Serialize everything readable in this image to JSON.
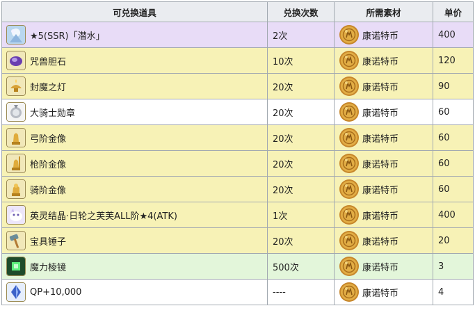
{
  "header": {
    "col_item": "可兑换道具",
    "col_times": "兑换次数",
    "col_material": "所需素材",
    "col_price": "单价"
  },
  "rows": [
    {
      "item": "★5(SSR)「潜水」",
      "times": "2次",
      "material": "康诺特币",
      "price": "400",
      "bg": "purple",
      "icon": "ssr-card-icon"
    },
    {
      "item": "咒兽胆石",
      "times": "10次",
      "material": "康诺特币",
      "price": "120",
      "bg": "yellow",
      "icon": "purple-gem-icon"
    },
    {
      "item": "封魔之灯",
      "times": "20次",
      "material": "康诺特币",
      "price": "90",
      "bg": "yellow",
      "icon": "lamp-icon"
    },
    {
      "item": "大骑士勋章",
      "times": "20次",
      "material": "康诺特币",
      "price": "60",
      "bg": "white",
      "icon": "medal-icon"
    },
    {
      "item": "弓阶金像",
      "times": "20次",
      "material": "康诺特币",
      "price": "60",
      "bg": "yellow",
      "icon": "archer-statue-icon"
    },
    {
      "item": "枪阶金像",
      "times": "20次",
      "material": "康诺特币",
      "price": "60",
      "bg": "yellow",
      "icon": "lancer-statue-icon"
    },
    {
      "item": "骑阶金像",
      "times": "20次",
      "material": "康诺特币",
      "price": "60",
      "bg": "yellow",
      "icon": "rider-statue-icon"
    },
    {
      "item": "英灵结晶·日轮之芙芙ALL阶★4(ATK)",
      "times": "1次",
      "material": "康诺特币",
      "price": "400",
      "bg": "yellow",
      "icon": "fou-crystal-icon"
    },
    {
      "item": "宝具锤子",
      "times": "20次",
      "material": "康诺特币",
      "price": "20",
      "bg": "yellow",
      "icon": "hammer-icon"
    },
    {
      "item": "魔力棱镜",
      "times": "500次",
      "material": "康诺特币",
      "price": "3",
      "bg": "green",
      "icon": "green-prism-icon"
    },
    {
      "item": "QP+10,000",
      "times": "----",
      "material": "康诺特币",
      "price": "4",
      "bg": "white",
      "icon": "qp-crystal-icon"
    }
  ],
  "colors": {
    "header_bg": "#eaecf0",
    "purple_row": "#e8dcf7",
    "yellow_row": "#f7f2b6",
    "green_row": "#e3f6da",
    "border": "#a2a9b1",
    "coin_gold": "#d8a03a"
  }
}
